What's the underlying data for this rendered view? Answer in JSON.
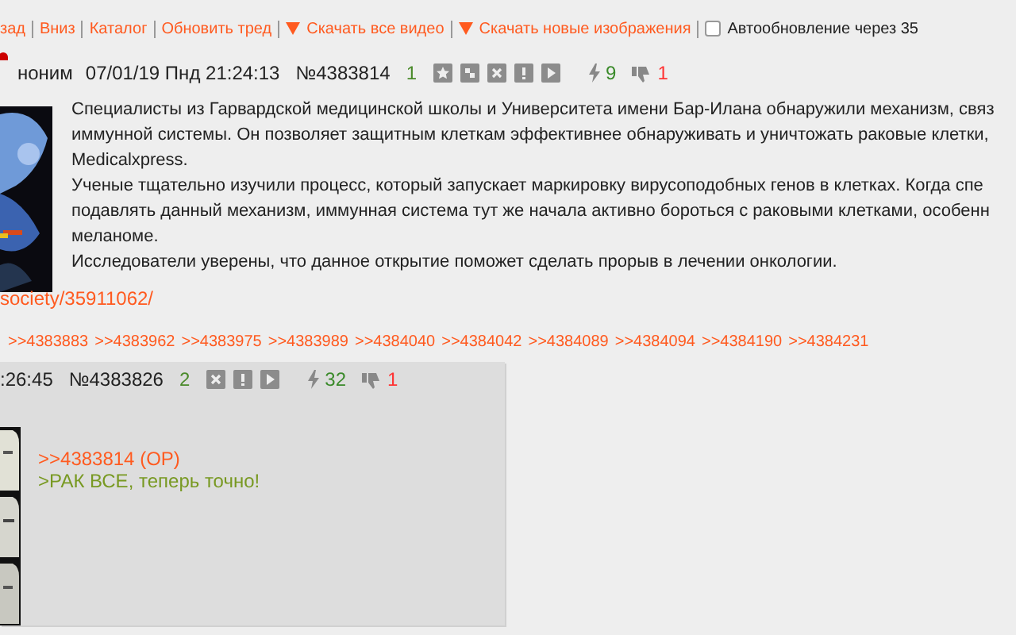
{
  "nav": {
    "links": [
      {
        "label": "зад",
        "kind": "link"
      },
      {
        "label": "Вниз",
        "kind": "link"
      },
      {
        "label": "Каталог",
        "kind": "link"
      },
      {
        "label": "Обновить тред",
        "kind": "link"
      },
      {
        "label": "Скачать все видео",
        "kind": "download"
      },
      {
        "label": "Скачать новые изображения",
        "kind": "download"
      }
    ],
    "autoupdate": {
      "label": "Автообновление через 35",
      "checked": false
    }
  },
  "op": {
    "author": "ноним",
    "date": "07/01/19 Пнд 21:24:13",
    "number": "№4383814",
    "index": "1",
    "icons": [
      {
        "kind": "star"
      },
      {
        "kind": "hide"
      },
      {
        "kind": "close"
      },
      {
        "kind": "report"
      },
      {
        "kind": "play"
      }
    ],
    "likes": "9",
    "dislikes": "1",
    "lines": [
      "Специалисты из Гарвардской медицинской школы и Университета имени Бар-Илана обнаружили механизм, связ",
      "иммунной системы. Он позволяет защитным клеткам эффективнее обнаруживать и уничтожать раковые клетки,",
      "Medicalxpress.",
      "Ученые тщательно изучили процесс, который запускает маркировку вирусоподобных генов в клетках. Когда спе",
      "подавлять данный механизм, иммунная система тут же начала активно бороться с раковыми клетками, особенн",
      "меланоме.",
      "Исследователи уверены, что данное открытие поможет сделать прорыв в лечении онкологии."
    ],
    "link": "society/35911062/",
    "replies": [
      ">>4383883",
      ">>4383962",
      ">>4383975",
      ">>4383989",
      ">>4384040",
      ">>4384042",
      ">>4384089",
      ">>4384094",
      ">>4384190",
      ">>4384231"
    ]
  },
  "reply": {
    "time": ":26:45",
    "number": "№4383826",
    "index": "2",
    "icons": [
      {
        "kind": "close"
      },
      {
        "kind": "report"
      },
      {
        "kind": "play"
      }
    ],
    "likes": "32",
    "dislikes": "1",
    "lines": [
      {
        "kind": "reply-link",
        "text": ">>4383814 (OP)"
      },
      {
        "kind": "quote",
        "text": ">РАК ВСЕ, теперь точно!"
      }
    ]
  }
}
